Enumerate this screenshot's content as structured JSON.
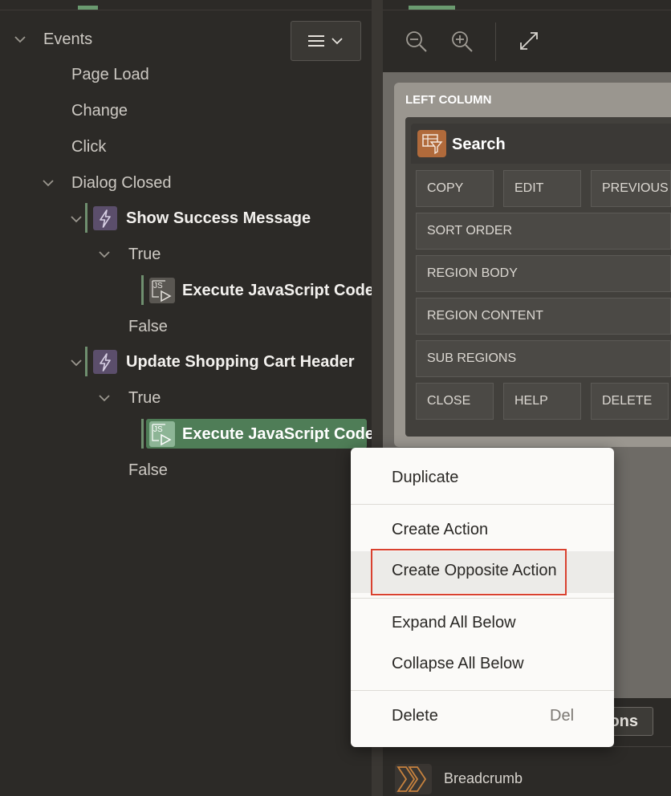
{
  "tree": {
    "root_label": "Events",
    "events": [
      "Page Load",
      "Change",
      "Click",
      "Dialog Closed"
    ],
    "action1": "Show Success Message",
    "action1_true": "True",
    "action1_js": "Execute JavaScript Code",
    "action1_false": "False",
    "action2": "Update Shopping Cart Header",
    "action2_true": "True",
    "action2_js": "Execute JavaScript Code",
    "action2_false": "False",
    "js_icon_text": "JS"
  },
  "canvas": {
    "left_column_label": "LEFT COLUMN",
    "region_title": "Search",
    "slots_row1": [
      "COPY",
      "EDIT",
      "PREVIOUS"
    ],
    "slot_sort_order": "SORT ORDER",
    "slot_region_body": "REGION BODY",
    "slot_region_content": "REGION CONTENT",
    "slot_sub_regions": "SUB REGIONS",
    "slots_row6": [
      "CLOSE",
      "HELP",
      "DELETE"
    ],
    "bottom_button_partial": "ons",
    "breadcrumb_label": "Breadcrumb"
  },
  "context_menu": {
    "duplicate": "Duplicate",
    "create_action": "Create Action",
    "create_opposite_action": "Create Opposite Action",
    "expand_all_below": "Expand All Below",
    "collapse_all_below": "Collapse All Below",
    "delete": "Delete",
    "delete_shortcut": "Del"
  },
  "colors": {
    "selected_row": "#4f7d57",
    "highlight_border": "#d9412f",
    "lightning_bg": "#5b4e6b",
    "region_icon_bg": "#b06a3b"
  }
}
